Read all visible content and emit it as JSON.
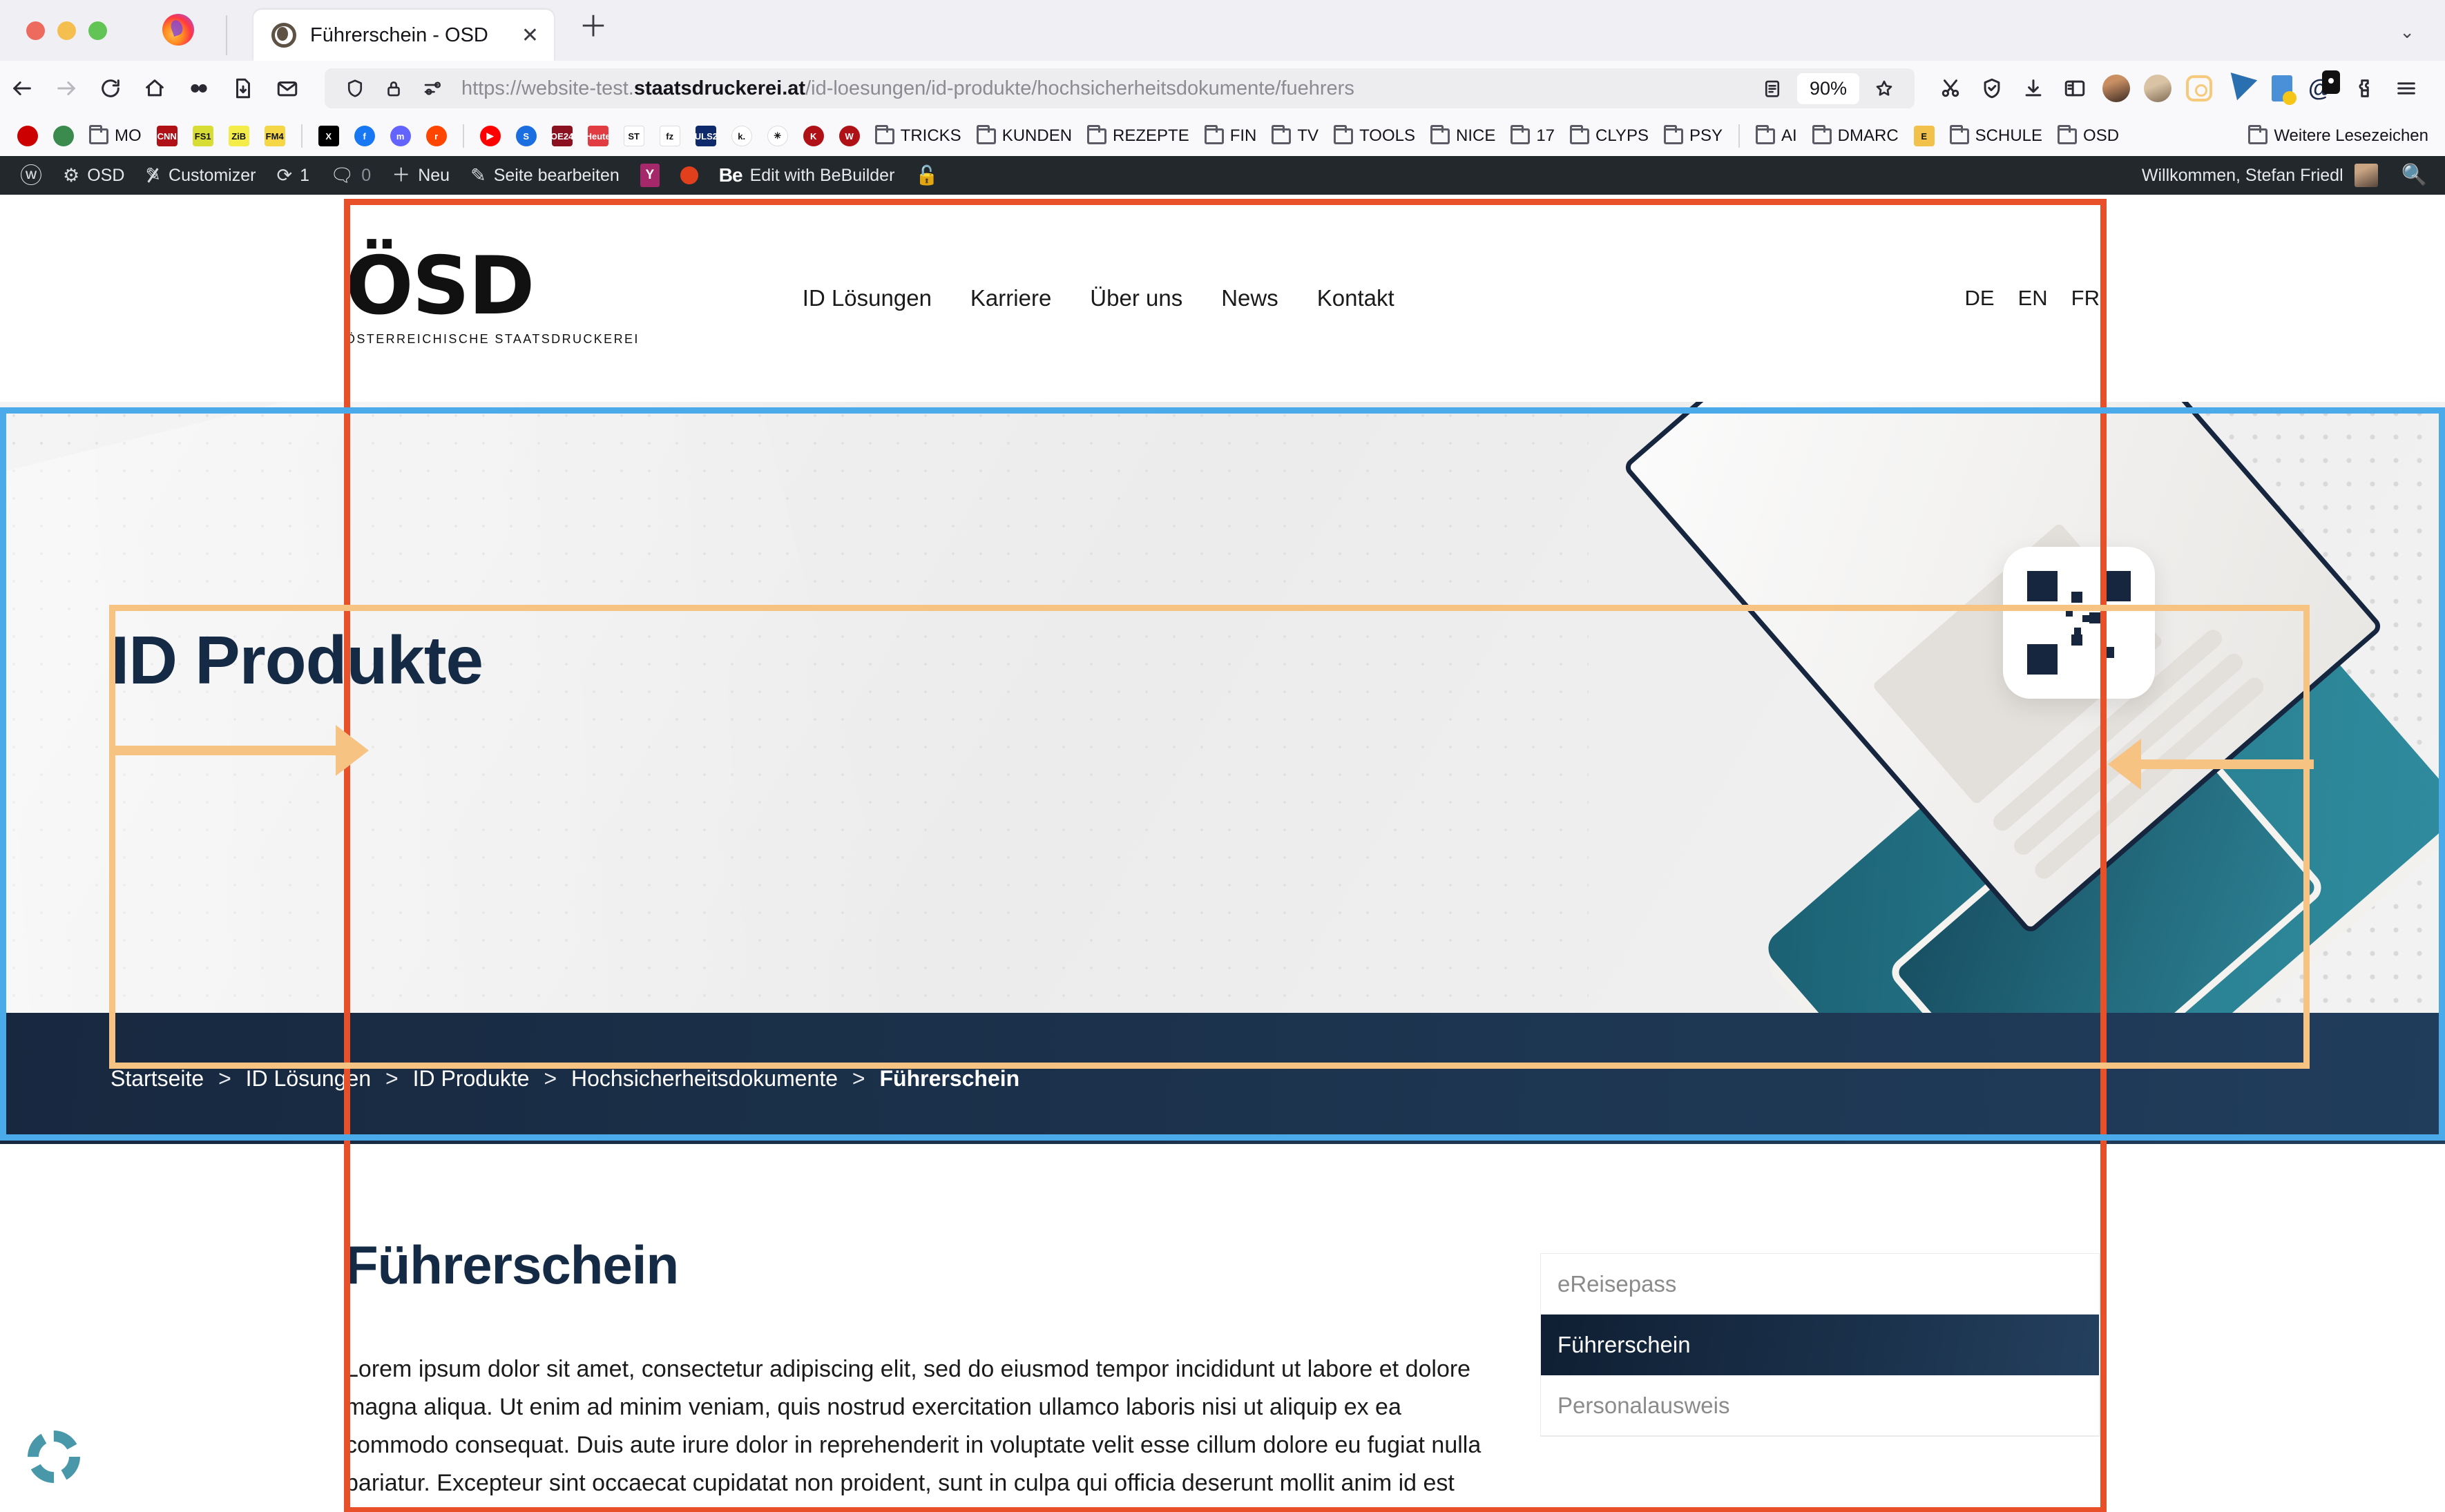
{
  "browser": {
    "tab": {
      "title": "Führerschein - OSD",
      "close_label": "✕",
      "new_tab_label": "＋"
    },
    "url": {
      "prefix": "https://website-test.",
      "domain": "staatsdruckerei.at",
      "path": "/id-loesungen/id-produkte/hochsicherheitsdokumente/fuehrers"
    },
    "zoom_level": "90%",
    "window_controls": [
      "close",
      "minimize",
      "maximize"
    ],
    "toolbar_icons": [
      "back-arrow",
      "forward-arrow",
      "reload",
      "home",
      "infinity-pocket",
      "save-page",
      "mail",
      "shield",
      "lock",
      "permissions-sliders",
      "reader-view",
      "bookmark-star"
    ],
    "right_icons": [
      "screenshot-scissors",
      "shield-check",
      "downloads",
      "sidebar-toggle",
      "profile-avatar",
      "container-avatar",
      "instagram",
      "lightning",
      "document-download",
      "mail-badge",
      "extension-puzzle",
      "hamburger-menu"
    ]
  },
  "bookmarks": {
    "items": [
      {
        "type": "icon",
        "name": "target-icon",
        "color": "#cc0000",
        "text": ""
      },
      {
        "type": "icon",
        "name": "greenpeace-icon",
        "color": "#3b8a4e",
        "text": ""
      },
      {
        "type": "folder",
        "name": "MO",
        "text": "MO"
      },
      {
        "type": "icon",
        "name": "cnn-icon",
        "color": "#b01116",
        "text": "CNN"
      },
      {
        "type": "icon",
        "name": "fs1-icon",
        "color": "#d8dd36",
        "text": "FS1"
      },
      {
        "type": "icon",
        "name": "zib-icon",
        "color": "#f4ec48",
        "text": "ZiB"
      },
      {
        "type": "icon",
        "name": "fm4-icon",
        "color": "#f4d646",
        "text": "FM4"
      },
      {
        "type": "sep"
      },
      {
        "type": "icon",
        "name": "x-twitter-icon",
        "color": "#000000",
        "text": "X"
      },
      {
        "type": "icon",
        "name": "facebook-icon",
        "color": "#1877f2",
        "text": "f"
      },
      {
        "type": "icon",
        "name": "mastodon-icon",
        "color": "#6364ff",
        "text": "m"
      },
      {
        "type": "icon",
        "name": "reddit-icon",
        "color": "#ff4500",
        "text": "r"
      },
      {
        "type": "sep"
      },
      {
        "type": "icon",
        "name": "youtube-icon",
        "color": "#ff0000",
        "text": "▶"
      },
      {
        "type": "icon",
        "name": "sparkasse-icon",
        "color": "#1a6ee0",
        "text": "S"
      },
      {
        "type": "icon",
        "name": "oe24-icon",
        "color": "#8b1020",
        "text": "OE24"
      },
      {
        "type": "icon",
        "name": "heute-icon",
        "color": "#e03c42",
        "text": "Heute"
      },
      {
        "type": "icon",
        "name": "standard-icon",
        "color": "#ffffff",
        "text": "ST"
      },
      {
        "type": "icon",
        "name": "falter-icon",
        "color": "#ffffff",
        "text": "fz"
      },
      {
        "type": "icon",
        "name": "puls24-icon",
        "color": "#0e2a6b",
        "text": "PULS24"
      },
      {
        "type": "icon",
        "name": "krone-kurier-icon",
        "color": "#ffffff",
        "text": "k."
      },
      {
        "type": "icon",
        "name": "edelweiss-icon",
        "color": "#ffffff",
        "text": "✳"
      },
      {
        "type": "icon",
        "name": "kurier-icon",
        "color": "#b01116",
        "text": "K"
      },
      {
        "type": "icon",
        "name": "wienerzeitung-icon",
        "color": "#b01116",
        "text": "W"
      },
      {
        "type": "folder",
        "name": "TRICKS",
        "text": "TRICKS"
      },
      {
        "type": "folder",
        "name": "KUNDEN",
        "text": "KUNDEN"
      },
      {
        "type": "folder",
        "name": "REZEPTE",
        "text": "REZEPTE"
      },
      {
        "type": "folder",
        "name": "FIN",
        "text": "FIN"
      },
      {
        "type": "folder",
        "name": "TV",
        "text": "TV"
      },
      {
        "type": "folder",
        "name": "TOOLS",
        "text": "TOOLS"
      },
      {
        "type": "folder",
        "name": "NICE",
        "text": "NICE"
      },
      {
        "type": "folder",
        "name": "17",
        "text": "17"
      },
      {
        "type": "folder",
        "name": "CLYPS",
        "text": "CLYPS"
      },
      {
        "type": "folder",
        "name": "PSY",
        "text": "PSY"
      },
      {
        "type": "sep"
      },
      {
        "type": "folder",
        "name": "AI",
        "text": "AI"
      },
      {
        "type": "folder",
        "name": "DMARC",
        "text": "DMARC"
      },
      {
        "type": "icon",
        "name": "evernote-icon",
        "color": "#f2c14b",
        "text": "E"
      },
      {
        "type": "folder",
        "name": "SCHULE",
        "text": "SCHULE"
      },
      {
        "type": "folder",
        "name": "OSD",
        "text": "OSD"
      }
    ],
    "overflow_label": "Weitere Lesezeichen"
  },
  "wp_admin_bar": {
    "items": [
      {
        "icon": "wordpress-logo-icon",
        "label": ""
      },
      {
        "icon": "dashboard-icon",
        "label": "OSD"
      },
      {
        "icon": "paintbrush-icon",
        "label": "Customizer"
      },
      {
        "icon": "update-icon",
        "label": "1"
      },
      {
        "icon": "comment-bubble-icon",
        "label": "0"
      },
      {
        "icon": "plus-icon",
        "label": "Neu"
      },
      {
        "icon": "pencil-icon",
        "label": "Seite bearbeiten"
      },
      {
        "icon": "yoast-seo-icon",
        "label": ""
      },
      {
        "icon": "red-status-dot-icon",
        "label": ""
      },
      {
        "icon": "bebuilder-icon",
        "label": "Edit with BeBuilder"
      },
      {
        "icon": "unlock-icon",
        "label": ""
      }
    ],
    "greeting": "Willkommen, Stefan Friedl",
    "search_icon": "search-icon"
  },
  "site": {
    "logo": {
      "name": "ÖSD",
      "tagline": "ÖSTERREICHISCHE STAATSDRUCKEREI"
    },
    "nav": [
      {
        "label": "ID Lösungen"
      },
      {
        "label": "Karriere"
      },
      {
        "label": "Über uns"
      },
      {
        "label": "News"
      },
      {
        "label": "Kontakt"
      }
    ],
    "languages": [
      {
        "code": "DE"
      },
      {
        "code": "EN"
      },
      {
        "code": "FR"
      }
    ],
    "hero": {
      "title": "ID Produkte"
    },
    "breadcrumb": {
      "items": [
        "Startseite",
        "ID Lösungen",
        "ID Produkte",
        "Hochsicherheitsdokumente",
        "Führerschein"
      ],
      "separator": ">"
    },
    "main": {
      "title": "Führerschein",
      "body": "Lorem ipsum dolor sit amet, consectetur adipiscing elit, sed do eiusmod tempor incididunt ut labore et dolore magna aliqua. Ut enim ad minim veniam, quis nostrud exercitation ullamco laboris nisi ut aliquip ex ea commodo consequat. Duis aute irure dolor in reprehenderit in voluptate velit esse cillum dolore eu fugiat nulla pariatur. Excepteur sint occaecat cupidatat non proident, sunt in culpa qui officia deserunt mollit anim id est"
    },
    "sidebar": {
      "items": [
        {
          "label": "eReisepass",
          "active": false
        },
        {
          "label": "Führerschein",
          "active": true
        },
        {
          "label": "Personalausweis",
          "active": false
        }
      ]
    },
    "colors": {
      "brand_navy": "#152a44",
      "brand_orange": "#e8502a",
      "teal": "#2e8b9d",
      "annotation_blue": "#4aaaea",
      "annotation_orange": "#f6c382"
    }
  }
}
